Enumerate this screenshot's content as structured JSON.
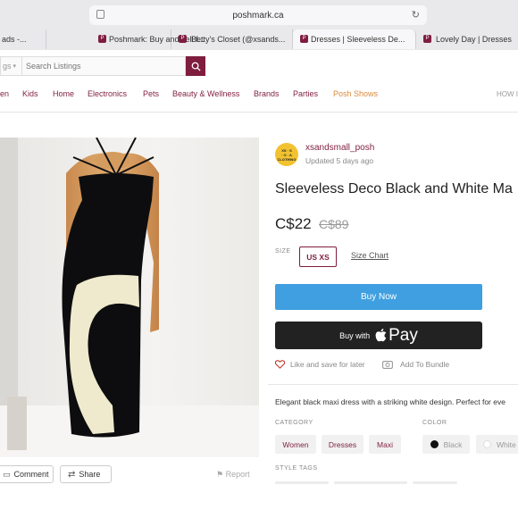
{
  "browser": {
    "url": "poshmark.ca",
    "tabs": [
      {
        "label": "ads -..."
      },
      {
        "label": "Poshmark: Buy and sell f..."
      },
      {
        "label": "Betty's Closet (@xsands..."
      },
      {
        "label": "Dresses | Sleeveless De..."
      },
      {
        "label": "Lovely Day | Dresses"
      }
    ]
  },
  "header": {
    "category_select": "gs",
    "search_placeholder": "Search Listings",
    "nav": [
      "en",
      "Kids",
      "Home",
      "Electronics",
      "Pets",
      "Beauty & Wellness",
      "Brands",
      "Parties",
      "Posh Shows",
      "HOW IT"
    ]
  },
  "listing": {
    "seller": {
      "username": "xsandsmall_posh",
      "updated": "Updated 5 days ago",
      "avatar_text": [
        "XS · S",
        "· O · A",
        "CLOTHING"
      ]
    },
    "title": "Sleeveless Deco Black and White Ma",
    "price": "C$22",
    "original_price": "C$89",
    "size_label": "SIZE",
    "size": "US XS",
    "size_chart": "Size Chart",
    "buy_now": "Buy Now",
    "apple_pay": {
      "buy_with": "Buy with",
      "pay": "Pay"
    },
    "like_label": "Like and save for later",
    "bundle_label": "Add To Bundle",
    "description": "Elegant black maxi dress with a striking white design. Perfect for eve",
    "category_label": "CATEGORY",
    "categories": [
      "Women",
      "Dresses",
      "Maxi"
    ],
    "color_label": "COLOR",
    "colors": [
      {
        "name": "Black",
        "swatch": "#111111"
      },
      {
        "name": "White",
        "swatch": "#ffffff"
      }
    ],
    "style_tags_label": "STYLE TAGS"
  },
  "photo_actions": {
    "comment": "Comment",
    "share": "Share",
    "report": "Report"
  },
  "colors": {
    "brand": "#7f1d3f",
    "buy_now": "#3f9fe0",
    "apple_pay": "#222222",
    "posh_shows": "#d98a3d"
  }
}
